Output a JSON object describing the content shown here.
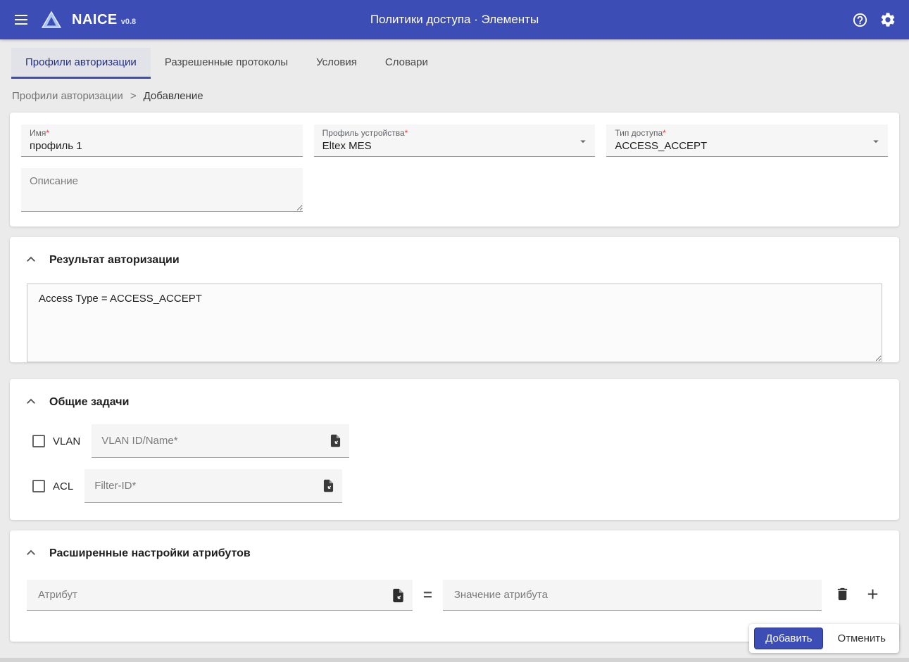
{
  "header": {
    "app_name": "NAICE",
    "app_version": "v0.8",
    "title": "Политики доступа · Элементы"
  },
  "tabs": [
    {
      "label": "Профили авторизации",
      "active": true
    },
    {
      "label": "Разрешенные протоколы",
      "active": false
    },
    {
      "label": "Условия",
      "active": false
    },
    {
      "label": "Словари",
      "active": false
    }
  ],
  "breadcrumb": {
    "root": "Профили авторизации",
    "separator": ">",
    "current": "Добавление"
  },
  "profile_form": {
    "name": {
      "label": "Имя",
      "required_mark": "*",
      "value": "профиль 1"
    },
    "device_profile": {
      "label": "Профиль устройства",
      "required_mark": "*",
      "value": "Eltex MES"
    },
    "access_type": {
      "label": "Тип доступа",
      "required_mark": "*",
      "value": "ACCESS_ACCEPT"
    },
    "description": {
      "placeholder": "Описание"
    }
  },
  "authorization_result": {
    "title": "Результат авторизации",
    "value": "Access Type = ACCESS_ACCEPT"
  },
  "common_tasks": {
    "title": "Общие задачи",
    "vlan": {
      "label": "VLAN",
      "checked": false,
      "placeholder": "VLAN ID/Name*"
    },
    "acl": {
      "label": "ACL",
      "checked": false,
      "placeholder": "Filter-ID*"
    }
  },
  "advanced_attributes": {
    "title": "Расширенные настройки атрибутов",
    "attribute_placeholder": "Атрибут",
    "equals_sign": "=",
    "value_placeholder": "Значение атрибута"
  },
  "actions": {
    "submit": "Добавить",
    "cancel": "Отменить"
  },
  "icons": {
    "menu-icon": "hamburger",
    "logo-icon": "triangle-logo",
    "help-icon": "circled question mark",
    "settings-icon": "gear",
    "collapse-icon": "chevron-up",
    "dropdown-icon": "triangle-down",
    "paste-icon": "document with import arrow",
    "delete-icon": "trash can",
    "add-icon": "plus",
    "resize-grip-icon": "diagonal lines"
  },
  "colors": {
    "header_bg": "#3c4db5",
    "accent": "#3c4db5",
    "required_asterisk": "#e53935",
    "page_bg": "#ebebeb"
  }
}
